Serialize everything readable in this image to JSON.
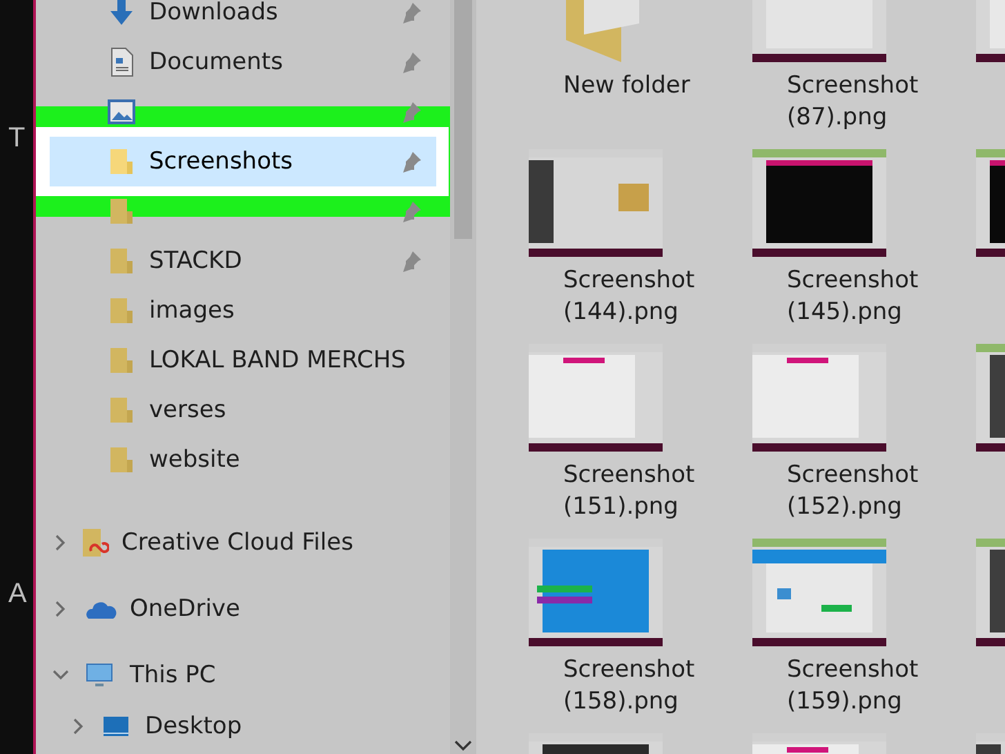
{
  "background_letters": [
    "T",
    "A"
  ],
  "sidebar": {
    "quick_access": [
      {
        "label": "Downloads",
        "kind": "download",
        "pinned": true,
        "selected": false
      },
      {
        "label": "Documents",
        "kind": "documents",
        "pinned": true,
        "selected": false
      },
      {
        "kind": "pictures",
        "pinned": true,
        "selected": false
      },
      {
        "label": "Screenshots",
        "kind": "folder",
        "pinned": true,
        "selected": true
      },
      {
        "kind": "folder",
        "pinned": true,
        "selected": false
      },
      {
        "label": "STACKD",
        "kind": "folder",
        "pinned": true,
        "selected": false
      },
      {
        "label": "images",
        "kind": "folder",
        "pinned": false,
        "selected": false
      },
      {
        "label": "LOKAL BAND MERCHS",
        "kind": "folder",
        "pinned": false,
        "selected": false
      },
      {
        "label": "verses",
        "kind": "folder",
        "pinned": false,
        "selected": false
      },
      {
        "label": "website",
        "kind": "folder",
        "pinned": false,
        "selected": false
      }
    ],
    "tree": [
      {
        "label": "Creative Cloud Files",
        "kind": "creative-cloud",
        "expanded": false
      },
      {
        "label": "OneDrive",
        "kind": "onedrive",
        "expanded": false
      },
      {
        "label": "This PC",
        "kind": "computer",
        "expanded": true,
        "children": [
          {
            "label": "Desktop",
            "kind": "desktop",
            "expanded": false
          }
        ]
      }
    ]
  },
  "files": [
    {
      "name": "New folder",
      "kind": "folder"
    },
    {
      "name": "Screenshot (87).png",
      "kind": "picture"
    },
    {
      "kind": "picture"
    },
    {
      "name": "Screenshot (144).png",
      "kind": "picture"
    },
    {
      "name": "Screenshot (145).png",
      "kind": "picture"
    },
    {
      "kind": "picture"
    },
    {
      "name": "Screenshot (151).png",
      "kind": "picture"
    },
    {
      "name": "Screenshot (152).png",
      "kind": "picture"
    },
    {
      "kind": "picture"
    },
    {
      "name": "Screenshot (158).png",
      "kind": "picture"
    },
    {
      "name": "Screenshot (159).png",
      "kind": "picture"
    },
    {
      "kind": "picture"
    },
    {
      "kind": "picture"
    },
    {
      "kind": "picture"
    },
    {
      "kind": "picture"
    }
  ]
}
